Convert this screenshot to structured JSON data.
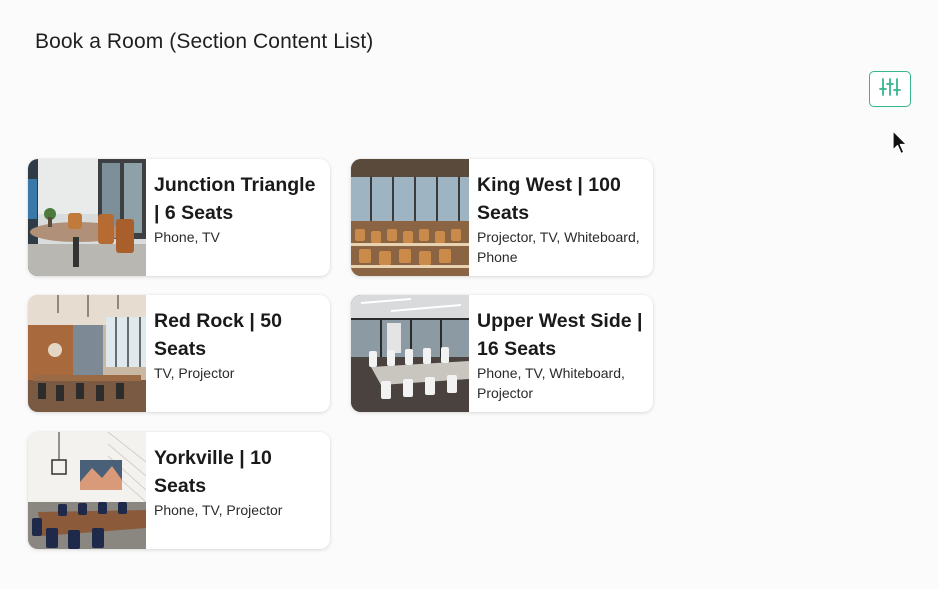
{
  "page": {
    "title": "Book a Room (Section Content List)"
  },
  "toolbar": {
    "filter_icon": "sliders-icon",
    "accent_color": "#36b58e"
  },
  "rooms": [
    {
      "title": "Junction Triangle | 6 Seats",
      "amenities": "Phone, TV"
    },
    {
      "title": "King West | 100 Seats",
      "amenities": "Projector, TV, Whiteboard, Phone"
    },
    {
      "title": "Red Rock | 50 Seats",
      "amenities": "TV, Projector"
    },
    {
      "title": "Upper West Side | 16 Seats",
      "amenities": "Phone, TV, Whiteboard, Projector"
    },
    {
      "title": "Yorkville | 10 Seats",
      "amenities": "Phone, TV, Projector"
    }
  ]
}
